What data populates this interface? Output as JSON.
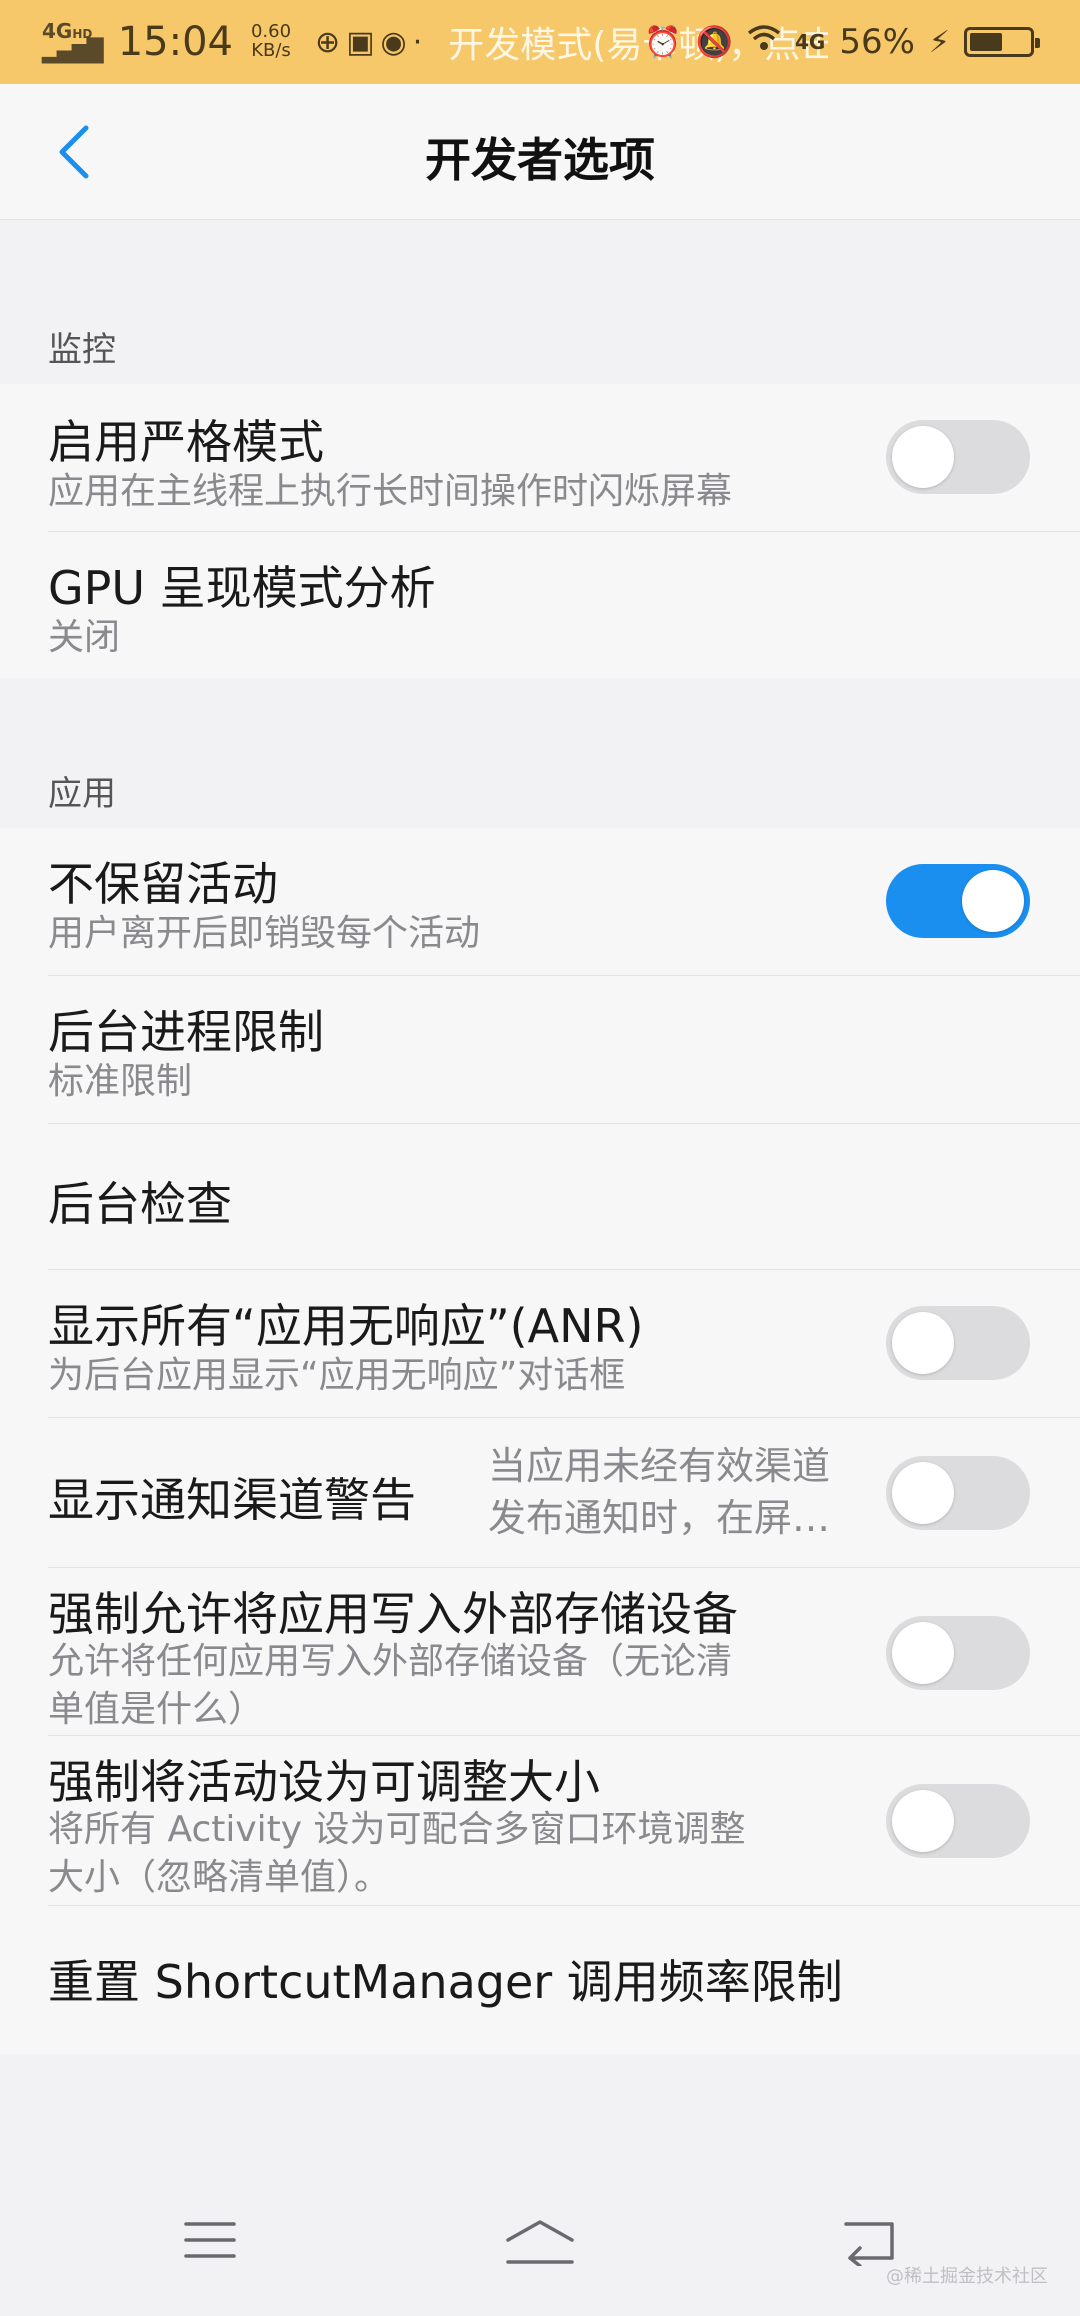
{
  "status_bar": {
    "network": "4G",
    "hd": "HD",
    "time": "15:04",
    "speed_value": "0.60",
    "speed_unit": "KB/s",
    "notice": "开发模式(易卡顿)，点击关闭",
    "network_right": "4G",
    "battery_percent": "56%",
    "battery_level": 0.56
  },
  "header": {
    "title": "开发者选项"
  },
  "sections": {
    "monitor": {
      "label": "监控",
      "rows": [
        {
          "title": "启用严格模式",
          "subtitle": "应用在主线程上执行长时间操作时闪烁屏幕",
          "toggle": false
        },
        {
          "title": "GPU 呈现模式分析",
          "subtitle": "关闭"
        }
      ]
    },
    "apps": {
      "label": "应用",
      "rows": [
        {
          "title": "不保留活动",
          "subtitle": "用户离开后即销毁每个活动",
          "toggle": true
        },
        {
          "title": "后台进程限制",
          "subtitle": "标准限制"
        },
        {
          "title": "后台检查"
        },
        {
          "title": "显示所有“应用无响应”(ANR)",
          "subtitle": "为后台应用显示“应用无响应”对话框",
          "toggle": false
        },
        {
          "title": "显示通知渠道警告",
          "side_line1": "当应用未经有效渠道",
          "side_line2": "发布通知时，在屏…",
          "toggle": false
        },
        {
          "title": "强制允许将应用写入外部存储设备",
          "subtitle_line1": "允许将任何应用写入外部存储设备（无论清",
          "subtitle_line2": "单值是什么）",
          "toggle": false
        },
        {
          "title": "强制将活动设为可调整大小",
          "subtitle_line1": "将所有 Activity 设为可配合多窗口环境调整",
          "subtitle_line2": "大小（忽略清单值）。",
          "toggle": false
        },
        {
          "title": "重置 ShortcutManager 调用频率限制"
        }
      ]
    }
  },
  "watermark": "@稀土掘金技术社区",
  "colors": {
    "status_bar": "#f6c86a",
    "accent": "#1a8ff0",
    "toggle_off": "#dcdcde"
  }
}
